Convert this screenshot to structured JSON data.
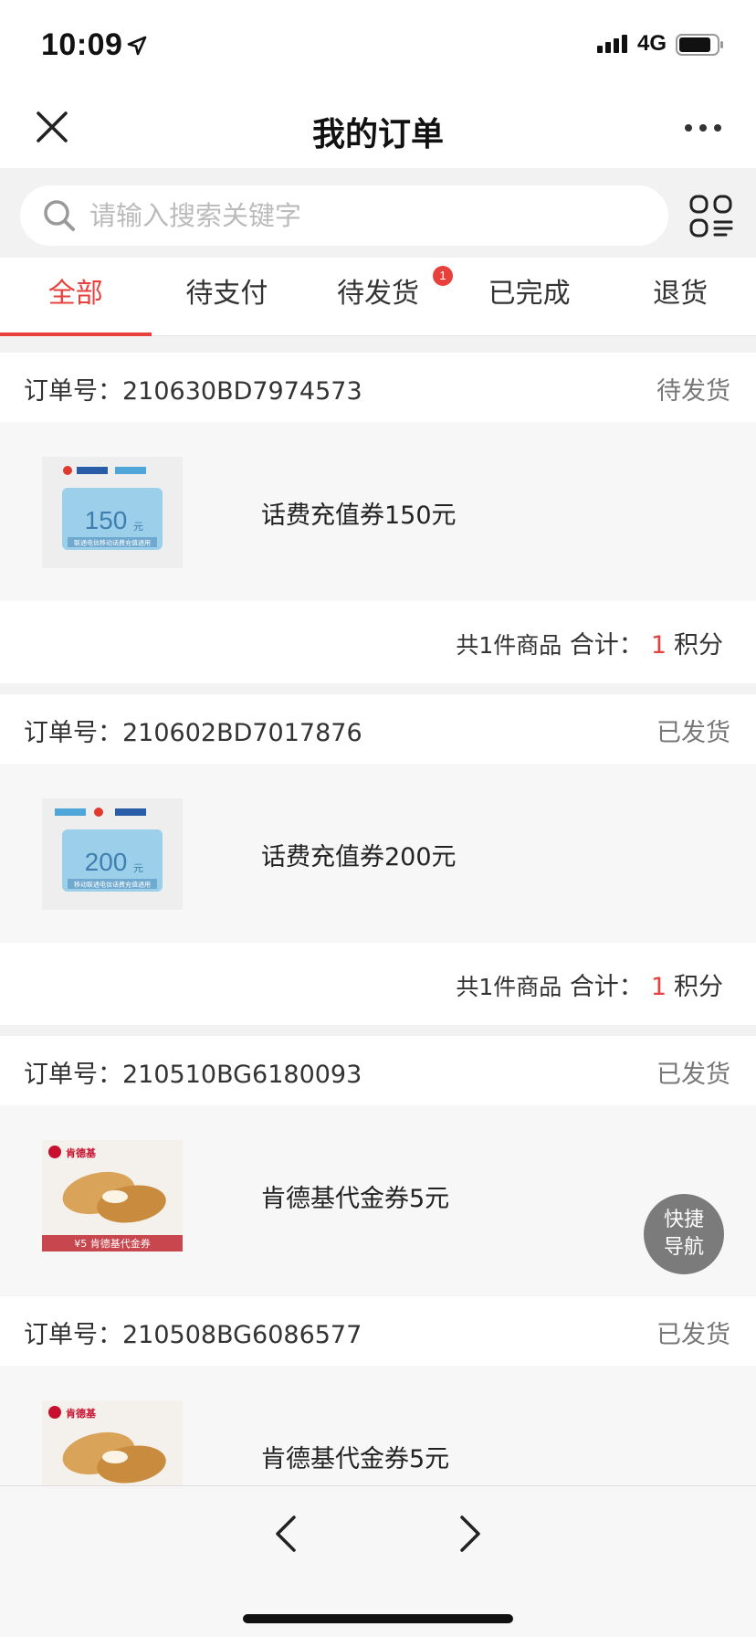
{
  "status_bar": {
    "time": "10:09",
    "network": "4G"
  },
  "header": {
    "title": "我的订单"
  },
  "search": {
    "placeholder": "请输入搜索关键字"
  },
  "tabs": [
    {
      "label": "全部",
      "active": true
    },
    {
      "label": "待支付"
    },
    {
      "label": "待发货",
      "badge": "1"
    },
    {
      "label": "已完成"
    },
    {
      "label": "退货"
    }
  ],
  "orders": [
    {
      "number_label": "订单号：210630BD7974573",
      "status": "待发货",
      "product": "话费充值券150元",
      "thumb_value": "150",
      "thumb_unit": "元",
      "thumb_caption": "联通电信移动话费充值通用",
      "summary_count": "共1件商品",
      "summary_total_label": "合计：",
      "summary_amount": "1",
      "summary_unit": "积分"
    },
    {
      "number_label": "订单号：210602BD7017876",
      "status": "已发货",
      "product": "话费充值券200元",
      "thumb_value": "200",
      "thumb_unit": "元",
      "thumb_caption": "移动联通电信话费充值通用",
      "summary_count": "共1件商品",
      "summary_total_label": "合计：",
      "summary_amount": "1",
      "summary_unit": "积分"
    },
    {
      "number_label": "订单号：210510BG6180093",
      "status": "已发货",
      "product": "肯德基代金券5元",
      "thumb_brand": "肯德基",
      "thumb_caption": "¥5 肯德基代金券"
    },
    {
      "number_label": "订单号：210508BG6086577",
      "status": "已发货",
      "product": "肯德基代金券5元",
      "thumb_brand": "肯德基"
    }
  ],
  "quick_nav": {
    "line1": "快捷",
    "line2": "导航"
  },
  "colors": {
    "accent": "#e8403d",
    "background": "#f2f2f2"
  }
}
